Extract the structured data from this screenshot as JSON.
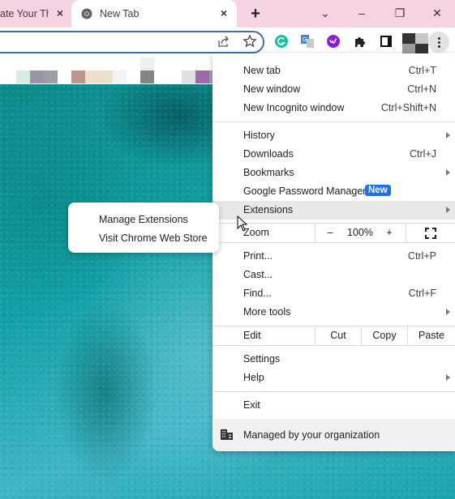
{
  "tabs": [
    {
      "title": "ate Your Th",
      "active": false,
      "close_icon": "×"
    },
    {
      "title": "New Tab",
      "active": true,
      "close_icon": "×"
    }
  ],
  "tabstrip": {
    "new_tab_icon": "+",
    "tab_search_icon": "⌄",
    "minimize_icon": "–",
    "restore_icon": "❐",
    "close_icon": "✕"
  },
  "colors": {
    "tabstrip_bg": "#f5d3e2",
    "omnibox_border": "#3f6fa8",
    "badge_blue": "#1a73e8",
    "highlight": "#e8e8e8",
    "grammarly": "#15c39a",
    "wordtune": "#8a1fd1"
  },
  "toolbar": {
    "share_icon": "share-icon",
    "star_icon": "☆",
    "extensions": [
      "grammarly",
      "google-translate",
      "wordtune",
      "puzzle-extensions",
      "side-panel"
    ]
  },
  "menu": {
    "items_top": [
      {
        "label": "New tab",
        "shortcut": "Ctrl+T"
      },
      {
        "label": "New window",
        "shortcut": "Ctrl+N"
      },
      {
        "label": "New Incognito window",
        "shortcut": "Ctrl+Shift+N"
      }
    ],
    "items_mid": [
      {
        "label": "History",
        "shortcut": "",
        "submenu": true
      },
      {
        "label": "Downloads",
        "shortcut": "Ctrl+J"
      },
      {
        "label": "Bookmarks",
        "shortcut": "",
        "submenu": true
      },
      {
        "label": "Google Password Manager",
        "badge": "New"
      },
      {
        "label": "Extensions",
        "submenu": true,
        "highlighted": true
      }
    ],
    "zoom": {
      "label": "Zoom",
      "minus": "–",
      "value": "100%",
      "plus": "+",
      "fullscreen_icon": "fullscreen-icon"
    },
    "items_tools": [
      {
        "label": "Print...",
        "shortcut": "Ctrl+P"
      },
      {
        "label": "Cast...",
        "shortcut": ""
      },
      {
        "label": "Find...",
        "shortcut": "Ctrl+F"
      },
      {
        "label": "More tools",
        "submenu": true
      }
    ],
    "edit": {
      "label": "Edit",
      "cut": "Cut",
      "copy": "Copy",
      "paste": "Paste"
    },
    "items_settings": [
      {
        "label": "Settings"
      },
      {
        "label": "Help",
        "submenu": true
      }
    ],
    "exit": "Exit",
    "managed": "Managed by your organization"
  },
  "submenu": {
    "items": [
      "Manage Extensions",
      "Visit Chrome Web Store"
    ]
  }
}
